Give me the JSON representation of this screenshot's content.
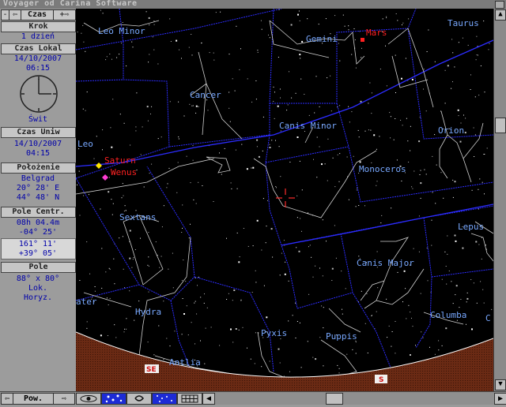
{
  "window": {
    "title": "Voyager od Carina Software"
  },
  "sidebar": {
    "time_nav": {
      "prev": "⇦",
      "label": "Czas",
      "next": "+⇨",
      "close": "-"
    },
    "step": {
      "header": "Krok",
      "value": "1 dzień"
    },
    "local_time": {
      "header": "Czas Lokal",
      "date": "14/10/2007",
      "time": "06:15",
      "twilight": "Świt"
    },
    "ut_time": {
      "header": "Czas Uniw",
      "date": "14/10/2007",
      "time": "04:15"
    },
    "location": {
      "header": "Położenie",
      "city": "Belgrad",
      "lon": "20° 28' E",
      "lat": "44° 48' N"
    },
    "center": {
      "header": "Pole Centr.",
      "ra": "08h 04.4m",
      "dec": "-04° 25'",
      "az": "161° 11'",
      "alt": "+39° 05'"
    },
    "field": {
      "header": "Pole",
      "size": "88° x 80°",
      "mode1": "Lok.",
      "mode2": "Horyz."
    }
  },
  "constellations": [
    "Leo Minor",
    "Gemini",
    "Taurus",
    "Cancer",
    "Canis Minor",
    "Orion",
    "Leo",
    "Monoceros",
    "Sextans",
    "Lepus",
    "Canis Major",
    "Hydra",
    "Columba",
    "Pyxis",
    "Puppis",
    "Antlia",
    "ater",
    "C"
  ],
  "planets": [
    {
      "name": "Mars",
      "color": "#ff2020"
    },
    {
      "name": "Saturn",
      "color": "#ffe600"
    },
    {
      "name": "Wenus",
      "color": "#ff3cd2"
    }
  ],
  "horizon_markers": [
    "SE",
    "S"
  ],
  "colors": {
    "constellation_label": "#78a8ff",
    "boundary": "#2222ff",
    "horizon": "#6a2a14"
  },
  "bottombar": {
    "left_arrow": "⇦",
    "label": "Pow.",
    "right_arrow": "⇨"
  }
}
